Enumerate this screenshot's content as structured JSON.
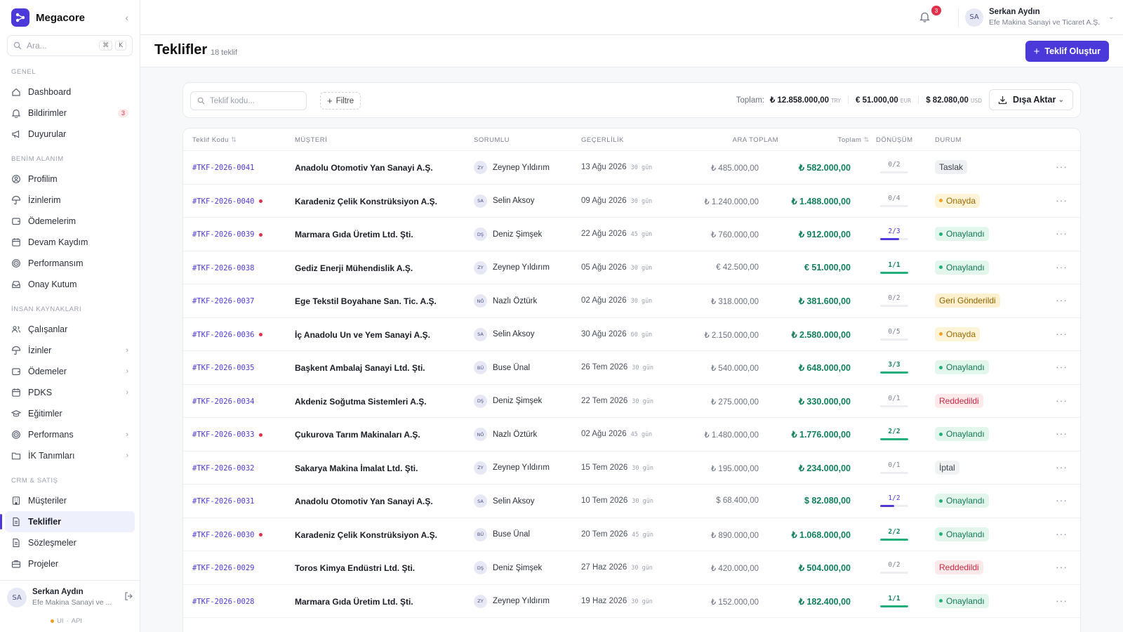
{
  "app": {
    "brand": "Megacore",
    "search_placeholder": "Ara...",
    "search_keys": [
      "⌘",
      "K"
    ]
  },
  "sidebar": {
    "sections": [
      {
        "label": "GENEL",
        "items": [
          {
            "label": "Dashboard",
            "icon": "home-icon"
          },
          {
            "label": "Bildirimler",
            "icon": "bell-icon",
            "badge": "3"
          },
          {
            "label": "Duyurular",
            "icon": "megaphone-icon"
          }
        ]
      },
      {
        "label": "BENİM ALANIM",
        "items": [
          {
            "label": "Profilim",
            "icon": "user-circle-icon"
          },
          {
            "label": "İzinlerim",
            "icon": "umbrella-icon"
          },
          {
            "label": "Ödemelerim",
            "icon": "wallet-icon"
          },
          {
            "label": "Devam Kaydım",
            "icon": "calendar-icon"
          },
          {
            "label": "Performansım",
            "icon": "target-icon"
          },
          {
            "label": "Onay Kutum",
            "icon": "inbox-icon"
          }
        ]
      },
      {
        "label": "İNSAN KAYNAKLARI",
        "items": [
          {
            "label": "Çalışanlar",
            "icon": "users-icon"
          },
          {
            "label": "İzinler",
            "icon": "umbrella-icon",
            "chevron": true
          },
          {
            "label": "Ödemeler",
            "icon": "wallet-icon",
            "chevron": true
          },
          {
            "label": "PDKS",
            "icon": "calendar-icon",
            "chevron": true
          },
          {
            "label": "Eğitimler",
            "icon": "graduation-cap-icon"
          },
          {
            "label": "Performans",
            "icon": "target-icon",
            "chevron": true
          },
          {
            "label": "İK Tanımları",
            "icon": "folder-icon",
            "chevron": true
          }
        ]
      },
      {
        "label": "CRM & SATIŞ",
        "items": [
          {
            "label": "Müşteriler",
            "icon": "building-icon"
          },
          {
            "label": "Teklifler",
            "icon": "document-icon",
            "active": true
          },
          {
            "label": "Sözleşmeler",
            "icon": "document-icon"
          },
          {
            "label": "Projeler",
            "icon": "briefcase-icon"
          }
        ]
      }
    ],
    "user": {
      "initials": "SA",
      "name": "Serkan Aydın",
      "org": "Efe Makina Sanayi ve ...",
      "footer": [
        "UI",
        "·",
        "API"
      ]
    }
  },
  "topbar": {
    "notif_count": "3",
    "user_initials": "SA",
    "user_name": "Serkan Aydın",
    "user_org": "Efe Makina Sanayi ve Ticaret A.Ş."
  },
  "page": {
    "title": "Teklifler",
    "count": "18 teklif",
    "create_label": "Teklif Oluştur"
  },
  "toolbar": {
    "search_placeholder": "Teklif kodu...",
    "filter_label": "Filtre",
    "totals_label": "Toplam:",
    "totals": [
      {
        "amount": "₺ 12.858.000,00",
        "currency": "TRY"
      },
      {
        "amount": "€ 51.000,00",
        "currency": "EUR"
      },
      {
        "amount": "$ 82.080,00",
        "currency": "USD"
      }
    ],
    "export_label": "Dışa Aktar"
  },
  "table": {
    "columns": {
      "code": "Teklif Kodu",
      "customer": "MÜŞTERİ",
      "owner": "SORUMLU",
      "validity": "GEÇERLİLİK",
      "subtotal": "ARA TOPLAM",
      "total": "Toplam",
      "conversion": "DÖNÜŞÜM",
      "status": "DURUM"
    },
    "rows": [
      {
        "code": "#TKF-2026-0041",
        "flag": false,
        "customer": "Anadolu Otomotiv Yan Sanayi A.Ş.",
        "owner_initials": "ZY",
        "owner": "Zeynep Yıldırım",
        "date": "13 Ağu 2026",
        "days": "30 gün",
        "subtotal": "₺ 485.000,00",
        "total": "₺ 582.000,00",
        "conv": "0/2",
        "conv_ratio": 0,
        "status": "Taslak",
        "status_kind": "draft"
      },
      {
        "code": "#TKF-2026-0040",
        "flag": true,
        "customer": "Karadeniz Çelik Konstrüksiyon A.Ş.",
        "owner_initials": "SA",
        "owner": "Selin Aksoy",
        "date": "09 Ağu 2026",
        "days": "30 gün",
        "subtotal": "₺ 1.240.000,00",
        "total": "₺ 1.488.000,00",
        "conv": "0/4",
        "conv_ratio": 0,
        "status": "Onayda",
        "status_kind": "pending"
      },
      {
        "code": "#TKF-2026-0039",
        "flag": true,
        "customer": "Marmara Gıda Üretim Ltd. Şti.",
        "owner_initials": "DŞ",
        "owner": "Deniz Şimşek",
        "date": "22 Ağu 2026",
        "days": "45 gün",
        "subtotal": "₺ 760.000,00",
        "total": "₺ 912.000,00",
        "conv": "2/3",
        "conv_ratio": 0.667,
        "status": "Onaylandı",
        "status_kind": "approved"
      },
      {
        "code": "#TKF-2026-0038",
        "flag": false,
        "customer": "Gediz Enerji Mühendislik A.Ş.",
        "owner_initials": "ZY",
        "owner": "Zeynep Yıldırım",
        "date": "05 Ağu 2026",
        "days": "30 gün",
        "subtotal": "€ 42.500,00",
        "total": "€ 51.000,00",
        "conv": "1/1",
        "conv_ratio": 1,
        "status": "Onaylandı",
        "status_kind": "approved"
      },
      {
        "code": "#TKF-2026-0037",
        "flag": false,
        "customer": "Ege Tekstil Boyahane San. Tic. A.Ş.",
        "owner_initials": "NÖ",
        "owner": "Nazlı Öztürk",
        "date": "02 Ağu 2026",
        "days": "30 gün",
        "subtotal": "₺ 318.000,00",
        "total": "₺ 381.600,00",
        "conv": "0/2",
        "conv_ratio": 0,
        "status": "Geri Gönderildi",
        "status_kind": "returned"
      },
      {
        "code": "#TKF-2026-0036",
        "flag": true,
        "customer": "İç Anadolu Un ve Yem Sanayi A.Ş.",
        "owner_initials": "SA",
        "owner": "Selin Aksoy",
        "date": "30 Ağu 2026",
        "days": "60 gün",
        "subtotal": "₺ 2.150.000,00",
        "total": "₺ 2.580.000,00",
        "conv": "0/5",
        "conv_ratio": 0,
        "status": "Onayda",
        "status_kind": "pending"
      },
      {
        "code": "#TKF-2026-0035",
        "flag": false,
        "customer": "Başkent Ambalaj Sanayi Ltd. Şti.",
        "owner_initials": "BÜ",
        "owner": "Buse Ünal",
        "date": "26 Tem 2026",
        "days": "30 gün",
        "subtotal": "₺ 540.000,00",
        "total": "₺ 648.000,00",
        "conv": "3/3",
        "conv_ratio": 1,
        "status": "Onaylandı",
        "status_kind": "approved"
      },
      {
        "code": "#TKF-2026-0034",
        "flag": false,
        "customer": "Akdeniz Soğutma Sistemleri A.Ş.",
        "owner_initials": "DŞ",
        "owner": "Deniz Şimşek",
        "date": "22 Tem 2026",
        "days": "30 gün",
        "subtotal": "₺ 275.000,00",
        "total": "₺ 330.000,00",
        "conv": "0/1",
        "conv_ratio": 0,
        "status": "Reddedildi",
        "status_kind": "rejected"
      },
      {
        "code": "#TKF-2026-0033",
        "flag": true,
        "customer": "Çukurova Tarım Makinaları A.Ş.",
        "owner_initials": "NÖ",
        "owner": "Nazlı Öztürk",
        "date": "02 Ağu 2026",
        "days": "45 gün",
        "subtotal": "₺ 1.480.000,00",
        "total": "₺ 1.776.000,00",
        "conv": "2/2",
        "conv_ratio": 1,
        "status": "Onaylandı",
        "status_kind": "approved"
      },
      {
        "code": "#TKF-2026-0032",
        "flag": false,
        "customer": "Sakarya Makina İmalat Ltd. Şti.",
        "owner_initials": "ZY",
        "owner": "Zeynep Yıldırım",
        "date": "15 Tem 2026",
        "days": "30 gün",
        "subtotal": "₺ 195.000,00",
        "total": "₺ 234.000,00",
        "conv": "0/1",
        "conv_ratio": 0,
        "status": "İptal",
        "status_kind": "cancelled"
      },
      {
        "code": "#TKF-2026-0031",
        "flag": false,
        "customer": "Anadolu Otomotiv Yan Sanayi A.Ş.",
        "owner_initials": "SA",
        "owner": "Selin Aksoy",
        "date": "10 Tem 2026",
        "days": "30 gün",
        "subtotal": "$ 68.400,00",
        "total": "$ 82.080,00",
        "conv": "1/2",
        "conv_ratio": 0.5,
        "status": "Onaylandı",
        "status_kind": "approved"
      },
      {
        "code": "#TKF-2026-0030",
        "flag": true,
        "customer": "Karadeniz Çelik Konstrüksiyon A.Ş.",
        "owner_initials": "BÜ",
        "owner": "Buse Ünal",
        "date": "20 Tem 2026",
        "days": "45 gün",
        "subtotal": "₺ 890.000,00",
        "total": "₺ 1.068.000,00",
        "conv": "2/2",
        "conv_ratio": 1,
        "status": "Onaylandı",
        "status_kind": "approved"
      },
      {
        "code": "#TKF-2026-0029",
        "flag": false,
        "customer": "Toros Kimya Endüstri Ltd. Şti.",
        "owner_initials": "DŞ",
        "owner": "Deniz Şimşek",
        "date": "27 Haz 2026",
        "days": "30 gün",
        "subtotal": "₺ 420.000,00",
        "total": "₺ 504.000,00",
        "conv": "0/2",
        "conv_ratio": 0,
        "status": "Reddedildi",
        "status_kind": "rejected"
      },
      {
        "code": "#TKF-2026-0028",
        "flag": false,
        "customer": "Marmara Gıda Üretim Ltd. Şti.",
        "owner_initials": "ZY",
        "owner": "Zeynep Yıldırım",
        "date": "19 Haz 2026",
        "days": "30 gün",
        "subtotal": "₺ 152.000,00",
        "total": "₺ 182.400,00",
        "conv": "1/1",
        "conv_ratio": 1,
        "status": "Onaylandı",
        "status_kind": "approved"
      }
    ]
  },
  "colors": {
    "accent": "#4b3ad9",
    "total_green": "#12805c",
    "status": {
      "draft": {
        "bg": "#eef0f3",
        "fg": "#3a3f4a",
        "dot": null
      },
      "pending": {
        "bg": "#fdf3d6",
        "fg": "#9a6a00",
        "dot": "#f0a020"
      },
      "approved": {
        "bg": "#e2f6ec",
        "fg": "#117a50",
        "dot": "#22b07a"
      },
      "returned": {
        "bg": "#fdf0cf",
        "fg": "#8a6400",
        "dot": null
      },
      "rejected": {
        "bg": "#fde8ea",
        "fg": "#c62a44",
        "dot": null
      },
      "cancelled": {
        "bg": "#f1f2f4",
        "fg": "#3a3f4a",
        "dot": null
      }
    }
  }
}
